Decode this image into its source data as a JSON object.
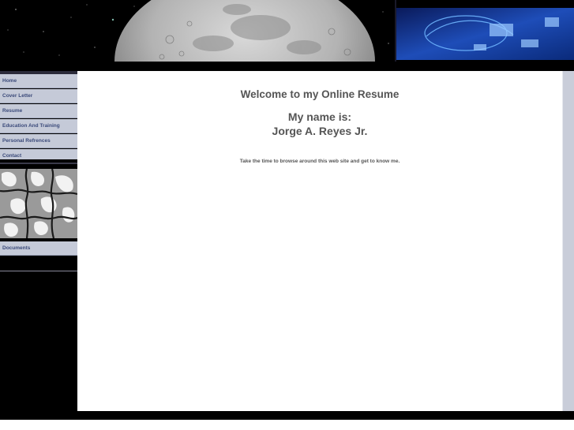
{
  "header": {
    "left_image": "moon-over-starfield",
    "right_image": "circuit-board-graphic"
  },
  "nav": {
    "items": [
      {
        "label": "Home"
      },
      {
        "label": "Cover Letter"
      },
      {
        "label": "Resume"
      },
      {
        "label": "Education And Training"
      },
      {
        "label": "Personal Refrences"
      },
      {
        "label": "Contact"
      }
    ],
    "secondary_items": [
      {
        "label": "Documents"
      }
    ],
    "texture_image": "abstract-grayscale-texture"
  },
  "main": {
    "welcome": "Welcome to my Online Resume",
    "name_label": "My name is:",
    "name_value": "Jorge A. Reyes Jr.",
    "intro": "Take the time to browse around this web site and get to know me."
  },
  "colors": {
    "nav_bg": "#c5cad8",
    "nav_text": "#3b4a7a",
    "body_text": "#555555",
    "page_bg": "#000000",
    "content_bg": "#ffffff"
  }
}
